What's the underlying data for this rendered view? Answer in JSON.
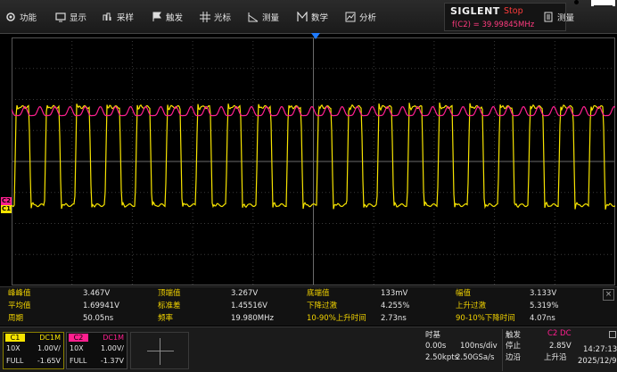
{
  "menu": {
    "items": [
      {
        "label": "功能",
        "icon": "gear-icon"
      },
      {
        "label": "显示",
        "icon": "monitor-icon"
      },
      {
        "label": "采样",
        "icon": "sampling-icon"
      },
      {
        "label": "触发",
        "icon": "flag-icon"
      },
      {
        "label": "光标",
        "icon": "cursor-grid-icon"
      },
      {
        "label": "测量",
        "icon": "measure-ruler-icon"
      },
      {
        "label": "数学",
        "icon": "math-icon"
      },
      {
        "label": "分析",
        "icon": "analysis-chart-icon"
      }
    ],
    "measure_right_label": "测量",
    "measure_right_icon": "document-icon"
  },
  "brand": {
    "logo": "SIGLENT",
    "run_state": "Stop",
    "frequency": "f(C2) = 39.99845MHz"
  },
  "corner_link": "______",
  "channel_markers": {
    "c1": "C1",
    "c2": "C2"
  },
  "measurements": {
    "rows": [
      [
        {
          "label": "峰峰值",
          "value": "3.467V"
        },
        {
          "label": "顶端值",
          "value": "3.267V"
        },
        {
          "label": "底端值",
          "value": "133mV"
        },
        {
          "label": "幅值",
          "value": "3.133V"
        }
      ],
      [
        {
          "label": "平均值",
          "value": "1.69941V"
        },
        {
          "label": "标准差",
          "value": "1.45516V"
        },
        {
          "label": "下降过激",
          "value": "4.255%"
        },
        {
          "label": "上升过激",
          "value": "5.319%"
        }
      ],
      [
        {
          "label": "周期",
          "value": "50.05ns"
        },
        {
          "label": "频率",
          "value": "19.980MHz"
        },
        {
          "label": "10-90%上升时间",
          "value": "2.73ns"
        },
        {
          "label": "90-10%下降时间",
          "value": "4.07ns"
        }
      ]
    ],
    "close_label": "×"
  },
  "channels": {
    "c1": {
      "tag": "C1",
      "coupling": "DC1M",
      "probe": "10X",
      "scale": "1.00V/",
      "bw": "FULL",
      "offset": "-1.65V",
      "color": "#f7e400"
    },
    "c2": {
      "tag": "C2",
      "coupling": "DC1M",
      "probe": "10X",
      "scale": "1.00V/",
      "bw": "FULL",
      "offset": "-1.37V",
      "color": "#ff1f8f"
    }
  },
  "timebase": {
    "title": "时基",
    "delay": "0.00s",
    "scale": "100ns/div",
    "memory": "2.50kpts",
    "sample_rate": "2.50GSa/s"
  },
  "trigger": {
    "title": "触发",
    "source": "C2 DC",
    "state": "停止",
    "level": "2.85V",
    "type": "边沿",
    "slope": "上升沿"
  },
  "clock": {
    "time": "14:27:13",
    "date": "2025/12/9"
  },
  "colors": {
    "ch1": "#f7e400",
    "ch2": "#ff1f8f",
    "label": "#f2d300",
    "stop": "#ff3b3b",
    "trigger_marker": "#1e7bff"
  }
}
